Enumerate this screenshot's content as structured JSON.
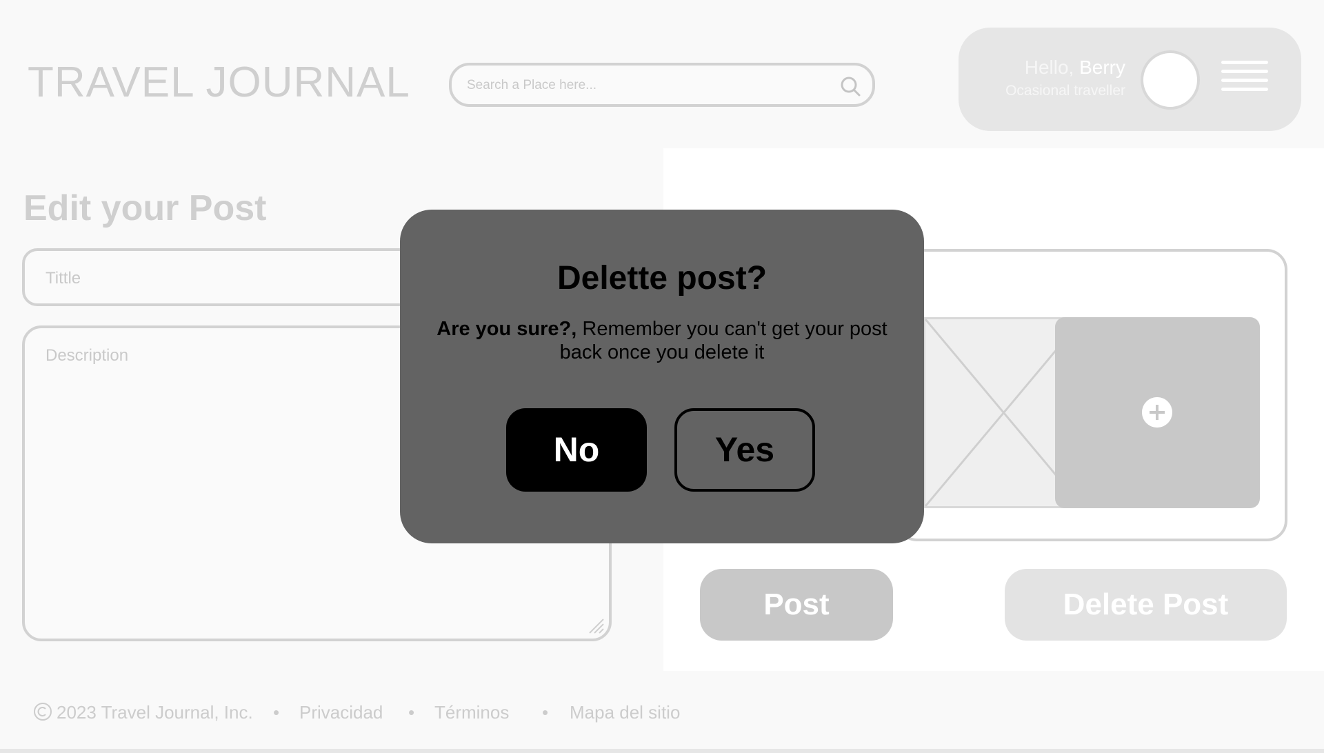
{
  "header": {
    "brand": "TRAVEL JOURNAL",
    "search_placeholder": "Search a Place here...",
    "search_icon": "search-icon",
    "user": {
      "greeting": "Hello,",
      "name": "Berry",
      "role": "Ocasional traveller",
      "avatar_icon": "avatar",
      "menu_icon": "hamburger-menu-icon"
    }
  },
  "form": {
    "page_title": "Edit your Post",
    "title_placeholder": "Tittle",
    "description_placeholder": "Description",
    "image_placeholder_icon": "image-placeholder-icon",
    "add_media_icon": "plus-icon",
    "post_label": "Post",
    "delete_label": "Delete Post"
  },
  "modal": {
    "title": "Delette post?",
    "body_bold": "Are you sure?,",
    "body_rest": " Remember you can't get your post back once you delete it",
    "no_label": "No",
    "yes_label": "Yes"
  },
  "footer": {
    "copyright": "2023 Travel Journal, Inc.",
    "links": [
      "Privacidad",
      "Términos",
      "Mapa del sitio"
    ],
    "separator": "•"
  },
  "colors": {
    "modal_bg": "#636363",
    "primary_button": "#000000",
    "disabled_text": "#c8c8c8"
  }
}
